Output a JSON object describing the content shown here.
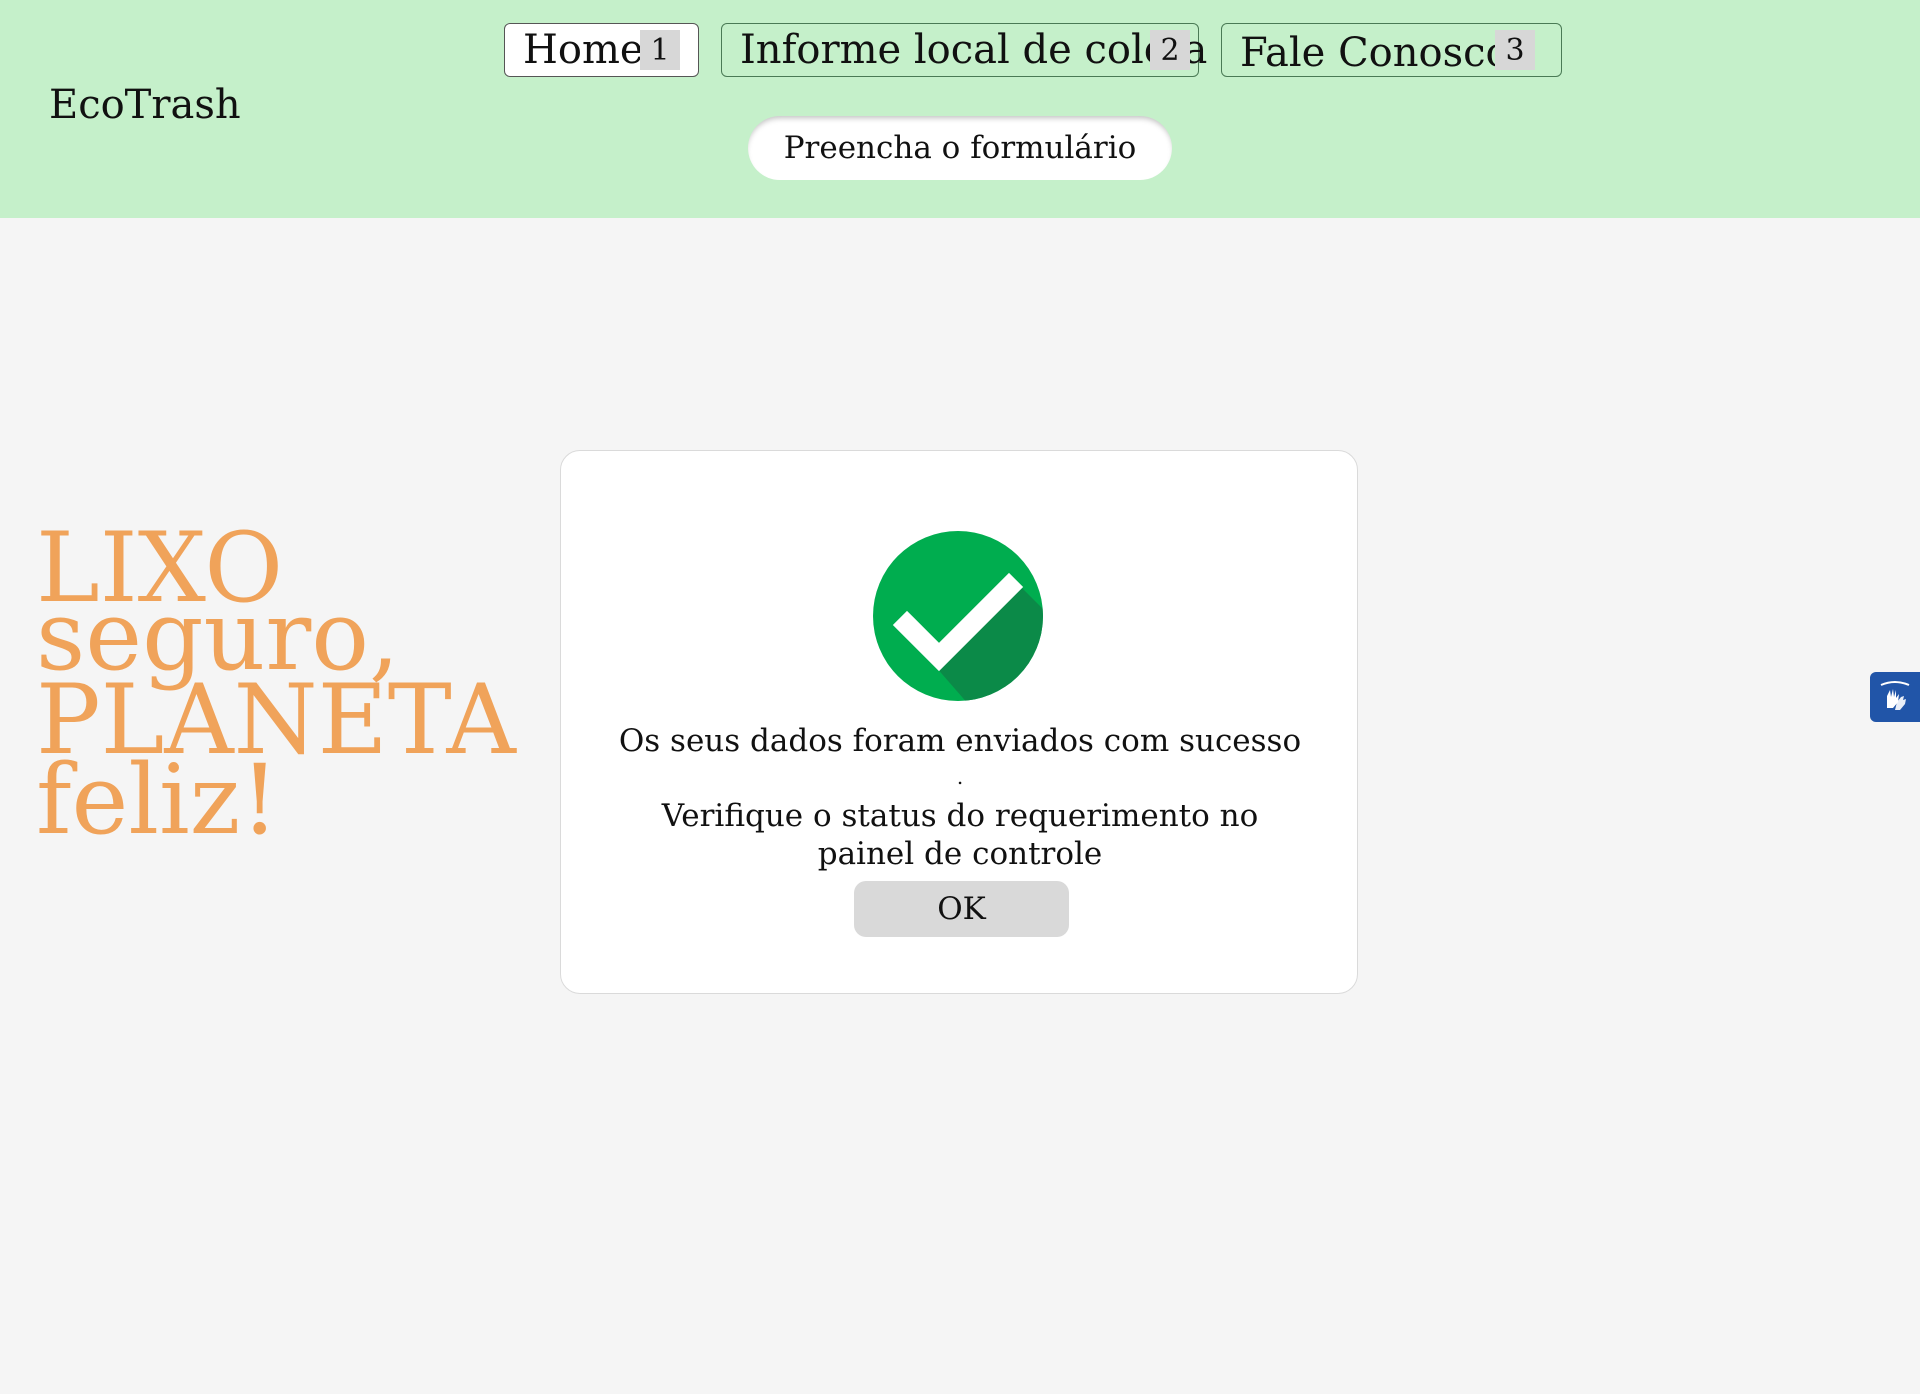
{
  "brand": "EcoTrash",
  "nav": {
    "items": [
      {
        "label": "Home",
        "number": "1"
      },
      {
        "label": "Informe local de coleta",
        "number": "2"
      },
      {
        "label": "Fale Conosco",
        "number": "3"
      }
    ]
  },
  "form_button": "Preencha o formulário",
  "slogan": {
    "line1": "LIXO",
    "line2": "seguro,",
    "line3": "PLANETA",
    "line4": "feliz!"
  },
  "modal": {
    "icon": "check-circle-icon",
    "message": "Os seus dados foram enviados com sucesso",
    "dot": ".",
    "detail": "Verifique o status do requerimento no painel de controle",
    "ok_label": "OK"
  },
  "accessibility_widget": {
    "icon": "sign-language-icon"
  },
  "colors": {
    "header_bg": "#c5f0ca",
    "slogan": "#f0a35a",
    "check_green": "#00ad4f",
    "check_shadow": "#0b8a48",
    "vlibras_blue": "#2155a8"
  }
}
